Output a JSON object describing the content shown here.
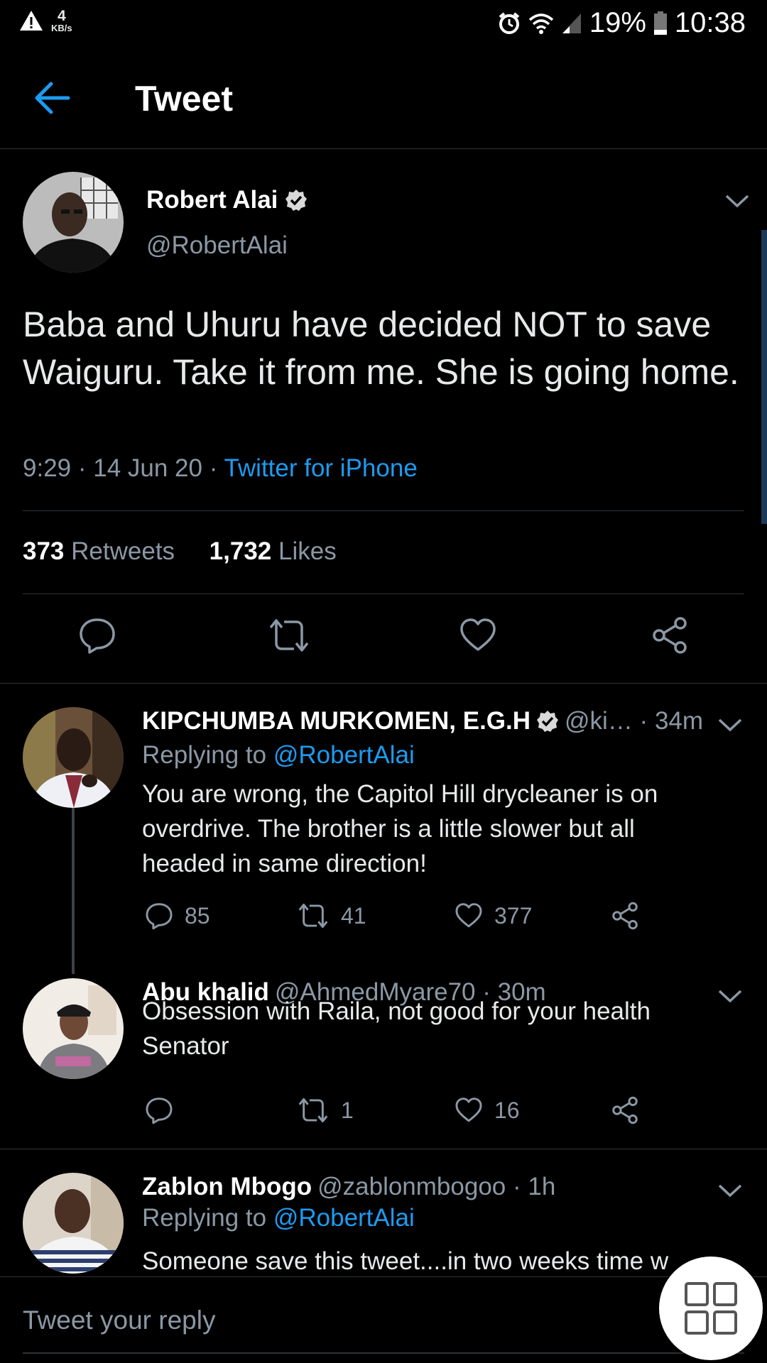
{
  "status_bar": {
    "net_speed_value": "4",
    "net_speed_unit": "KB/s",
    "battery": "19%",
    "time": "10:38"
  },
  "header": {
    "title": "Tweet"
  },
  "tweet": {
    "author_name": "Robert Alai",
    "author_handle": "@RobertAlai",
    "text": "Baba and Uhuru have decided NOT to save Waiguru. Take it from me. She is going home.",
    "time": "9:29 · 14 Jun 20 · ",
    "source": "Twitter for iPhone",
    "retweets_count": "373",
    "retweets_label": "Retweets",
    "likes_count": "1,732",
    "likes_label": "Likes"
  },
  "replies": [
    {
      "name": "KIPCHUMBA MURKOMEN, E.G.H",
      "handle_time": "@ki… · 34m",
      "replying_prefix": "Replying to ",
      "replying_to": "@RobertAlai",
      "text": "You are wrong, the Capitol Hill drycleaner is on overdrive. The brother is a little slower but all headed in same direction!",
      "reply_count": "85",
      "retweet_count": "41",
      "like_count": "377"
    },
    {
      "name": "Abu khalid",
      "handle_time": "@AhmedMyare70 · 30m",
      "text": "Obsession with Raila, not good for your health Senator",
      "reply_count": "",
      "retweet_count": "1",
      "like_count": "16"
    },
    {
      "name": "Zablon Mbogo",
      "handle_time": "@zablonmbogoo · 1h",
      "replying_prefix": "Replying to ",
      "replying_to": "@RobertAlai",
      "text": "Someone save this tweet....in two weeks time w"
    }
  ],
  "reply_bar": {
    "placeholder": "Tweet your reply"
  },
  "colors": {
    "accent": "#1d9bf0",
    "muted": "#8b98a5",
    "background": "#000000"
  }
}
